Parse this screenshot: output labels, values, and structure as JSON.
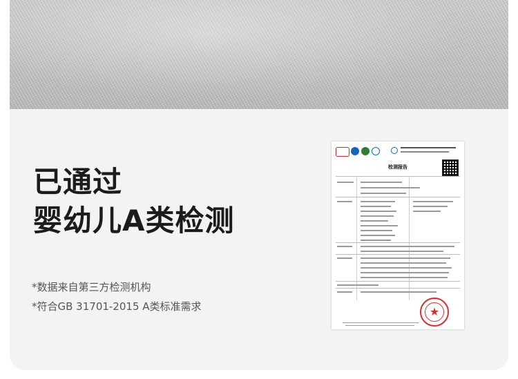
{
  "headline": {
    "line1": "已通过",
    "line2": "婴幼儿A类检测"
  },
  "notes": [
    "*数据来自第三方检测机构",
    "*符合GB 31701-2015 A类标准需求"
  ],
  "report": {
    "title": "检测报告"
  },
  "colors": {
    "seal": "#d32f2f",
    "panel": "#f3f3f3",
    "headline": "#1c1c1c",
    "notes": "#555555"
  },
  "icons": [
    "star-icon",
    "qr-code-icon"
  ]
}
